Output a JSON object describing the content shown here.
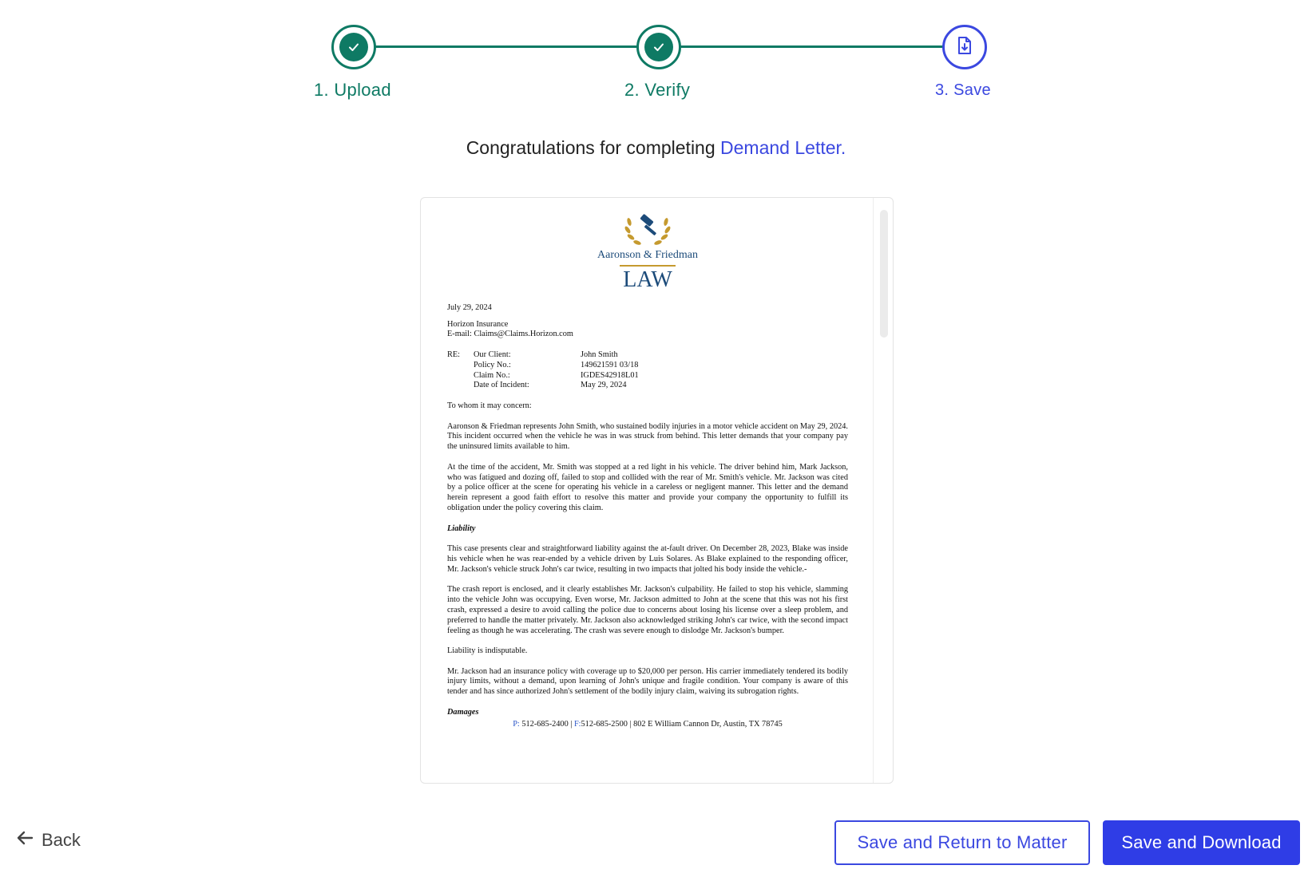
{
  "stepper": {
    "steps": [
      {
        "label": "1. Upload",
        "status": "complete",
        "icon": "check-icon"
      },
      {
        "label": "2. Verify",
        "status": "complete",
        "icon": "check-icon"
      },
      {
        "label": "3. Save",
        "status": "current",
        "icon": "file-download-icon"
      }
    ]
  },
  "header": {
    "congrats_text": "Congratulations for completing ",
    "document_name": "Demand Letter."
  },
  "letter": {
    "firm_name": "Aaronson & Friedman",
    "firm_law": "LAW",
    "date": "July 29, 2024",
    "recipient": "Horizon Insurance",
    "recipient_email": "E-mail: Claims@Claims.Horizon.com",
    "re": {
      "prefix": "RE:",
      "rows": [
        {
          "label": "Our Client:",
          "value": "John Smith"
        },
        {
          "label": "Policy No.:",
          "value": "149621591 03/18"
        },
        {
          "label": "Claim No.:",
          "value": "IGDES42918L01"
        },
        {
          "label": "Date of Incident:",
          "value": "May 29, 2024"
        }
      ]
    },
    "salutation": "To whom it may concern:",
    "para1": "Aaronson & Friedman represents John Smith, who sustained bodily injuries in a motor vehicle accident on May 29, 2024. This incident occurred when the vehicle he was in was struck from behind. This letter demands that your company pay the uninsured limits available to him.",
    "para2": "At the time of the accident, Mr. Smith was stopped at a red light in his vehicle. The driver behind him, Mark Jackson, who was fatigued and dozing off, failed to stop and collided with the rear of Mr. Smith's vehicle. Mr. Jackson was cited by a police officer at the scene for operating his vehicle in a careless or negligent manner. This letter and the demand herein represent a good faith effort to resolve this matter and provide your company the opportunity to fulfill its obligation under the policy covering this claim.",
    "liability_heading": "Liability",
    "para3": "This case presents clear and straightforward liability against the at-fault driver. On December 28, 2023, Blake was inside his vehicle when he was rear-ended by a vehicle driven by Luis Solares. As Blake explained to the responding officer, Mr. Jackson's vehicle struck John's car twice, resulting in two impacts that jolted his body inside the vehicle.-",
    "para4": "The crash report is enclosed, and it clearly establishes Mr. Jackson's culpability. He failed to stop his vehicle, slamming into the vehicle John was occupying. Even worse, Mr. Jackson admitted to John at the scene that this was not his first crash, expressed a desire to avoid calling the police due to concerns about losing his license over a sleep problem, and preferred to handle the matter privately. Mr. Jackson also acknowledged striking John's car twice, with the second impact feeling as though he was accelerating. The crash was severe enough to dislodge Mr. Jackson's bumper.",
    "para5": "Liability is indisputable.",
    "para6": "Mr. Jackson had an insurance policy with coverage up to $20,000 per person. His carrier immediately tendered its bodily injury limits, without a demand, upon learning of John's unique and fragile condition. Your company is aware of this tender and has since authorized John's settlement of the bodily injury claim, waiving its subrogation rights.",
    "damages_heading": "Damages",
    "footer": {
      "phone_label": "P:",
      "phone": " 512-685-2400 | ",
      "fax_label": "F:",
      "fax_rest": "512-685-2500 | 802 E William Cannon Dr, Austin, TX 78745"
    }
  },
  "actions": {
    "back_label": "Back",
    "save_return_label": "Save and Return to Matter",
    "save_download_label": "Save and Download"
  },
  "colors": {
    "complete": "#0e7a64",
    "current": "#3b48e0",
    "primary_button": "#2f3de6"
  }
}
